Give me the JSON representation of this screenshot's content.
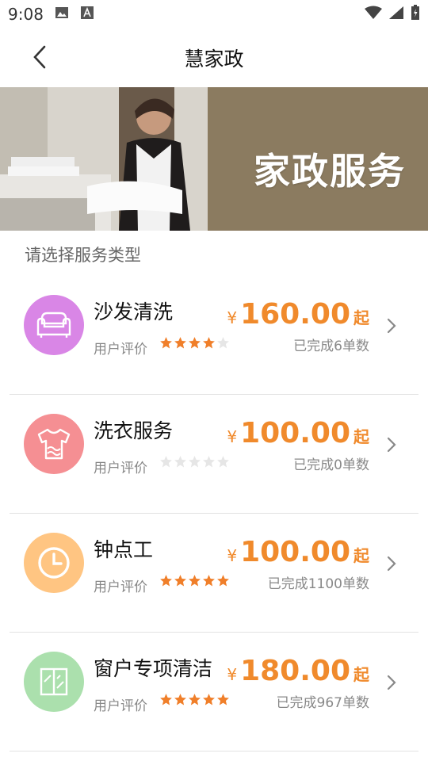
{
  "status_bar": {
    "time": "9:08"
  },
  "header": {
    "title": "慧家政"
  },
  "banner": {
    "text": "家政服务"
  },
  "section": {
    "title": "请选择服务类型"
  },
  "services": [
    {
      "name": "沙发清洗",
      "rating_label": "用户评价",
      "rating": 4,
      "currency": "¥",
      "price": "160.00",
      "suffix": "起",
      "completed": "已完成6单数",
      "icon": "sofa-icon",
      "color": "#d986e6"
    },
    {
      "name": "洗衣服务",
      "rating_label": "用户评价",
      "rating": 0,
      "currency": "¥",
      "price": "100.00",
      "suffix": "起",
      "completed": "已完成0单数",
      "icon": "clothes-icon",
      "color": "#f58f93"
    },
    {
      "name": "钟点工",
      "rating_label": "用户评价",
      "rating": 5,
      "currency": "¥",
      "price": "100.00",
      "suffix": "起",
      "completed": "已完成1100单数",
      "icon": "clock-icon",
      "color": "#ffc582"
    },
    {
      "name": "窗户专项清洁",
      "rating_label": "用户评价",
      "rating": 5,
      "currency": "¥",
      "price": "180.00",
      "suffix": "起",
      "completed": "已完成967单数",
      "icon": "window-icon",
      "color": "#abe0ad"
    }
  ],
  "colors": {
    "accent": "#f08a2c",
    "star_on": "#f07f2a",
    "star_off": "#e6e6e6"
  }
}
